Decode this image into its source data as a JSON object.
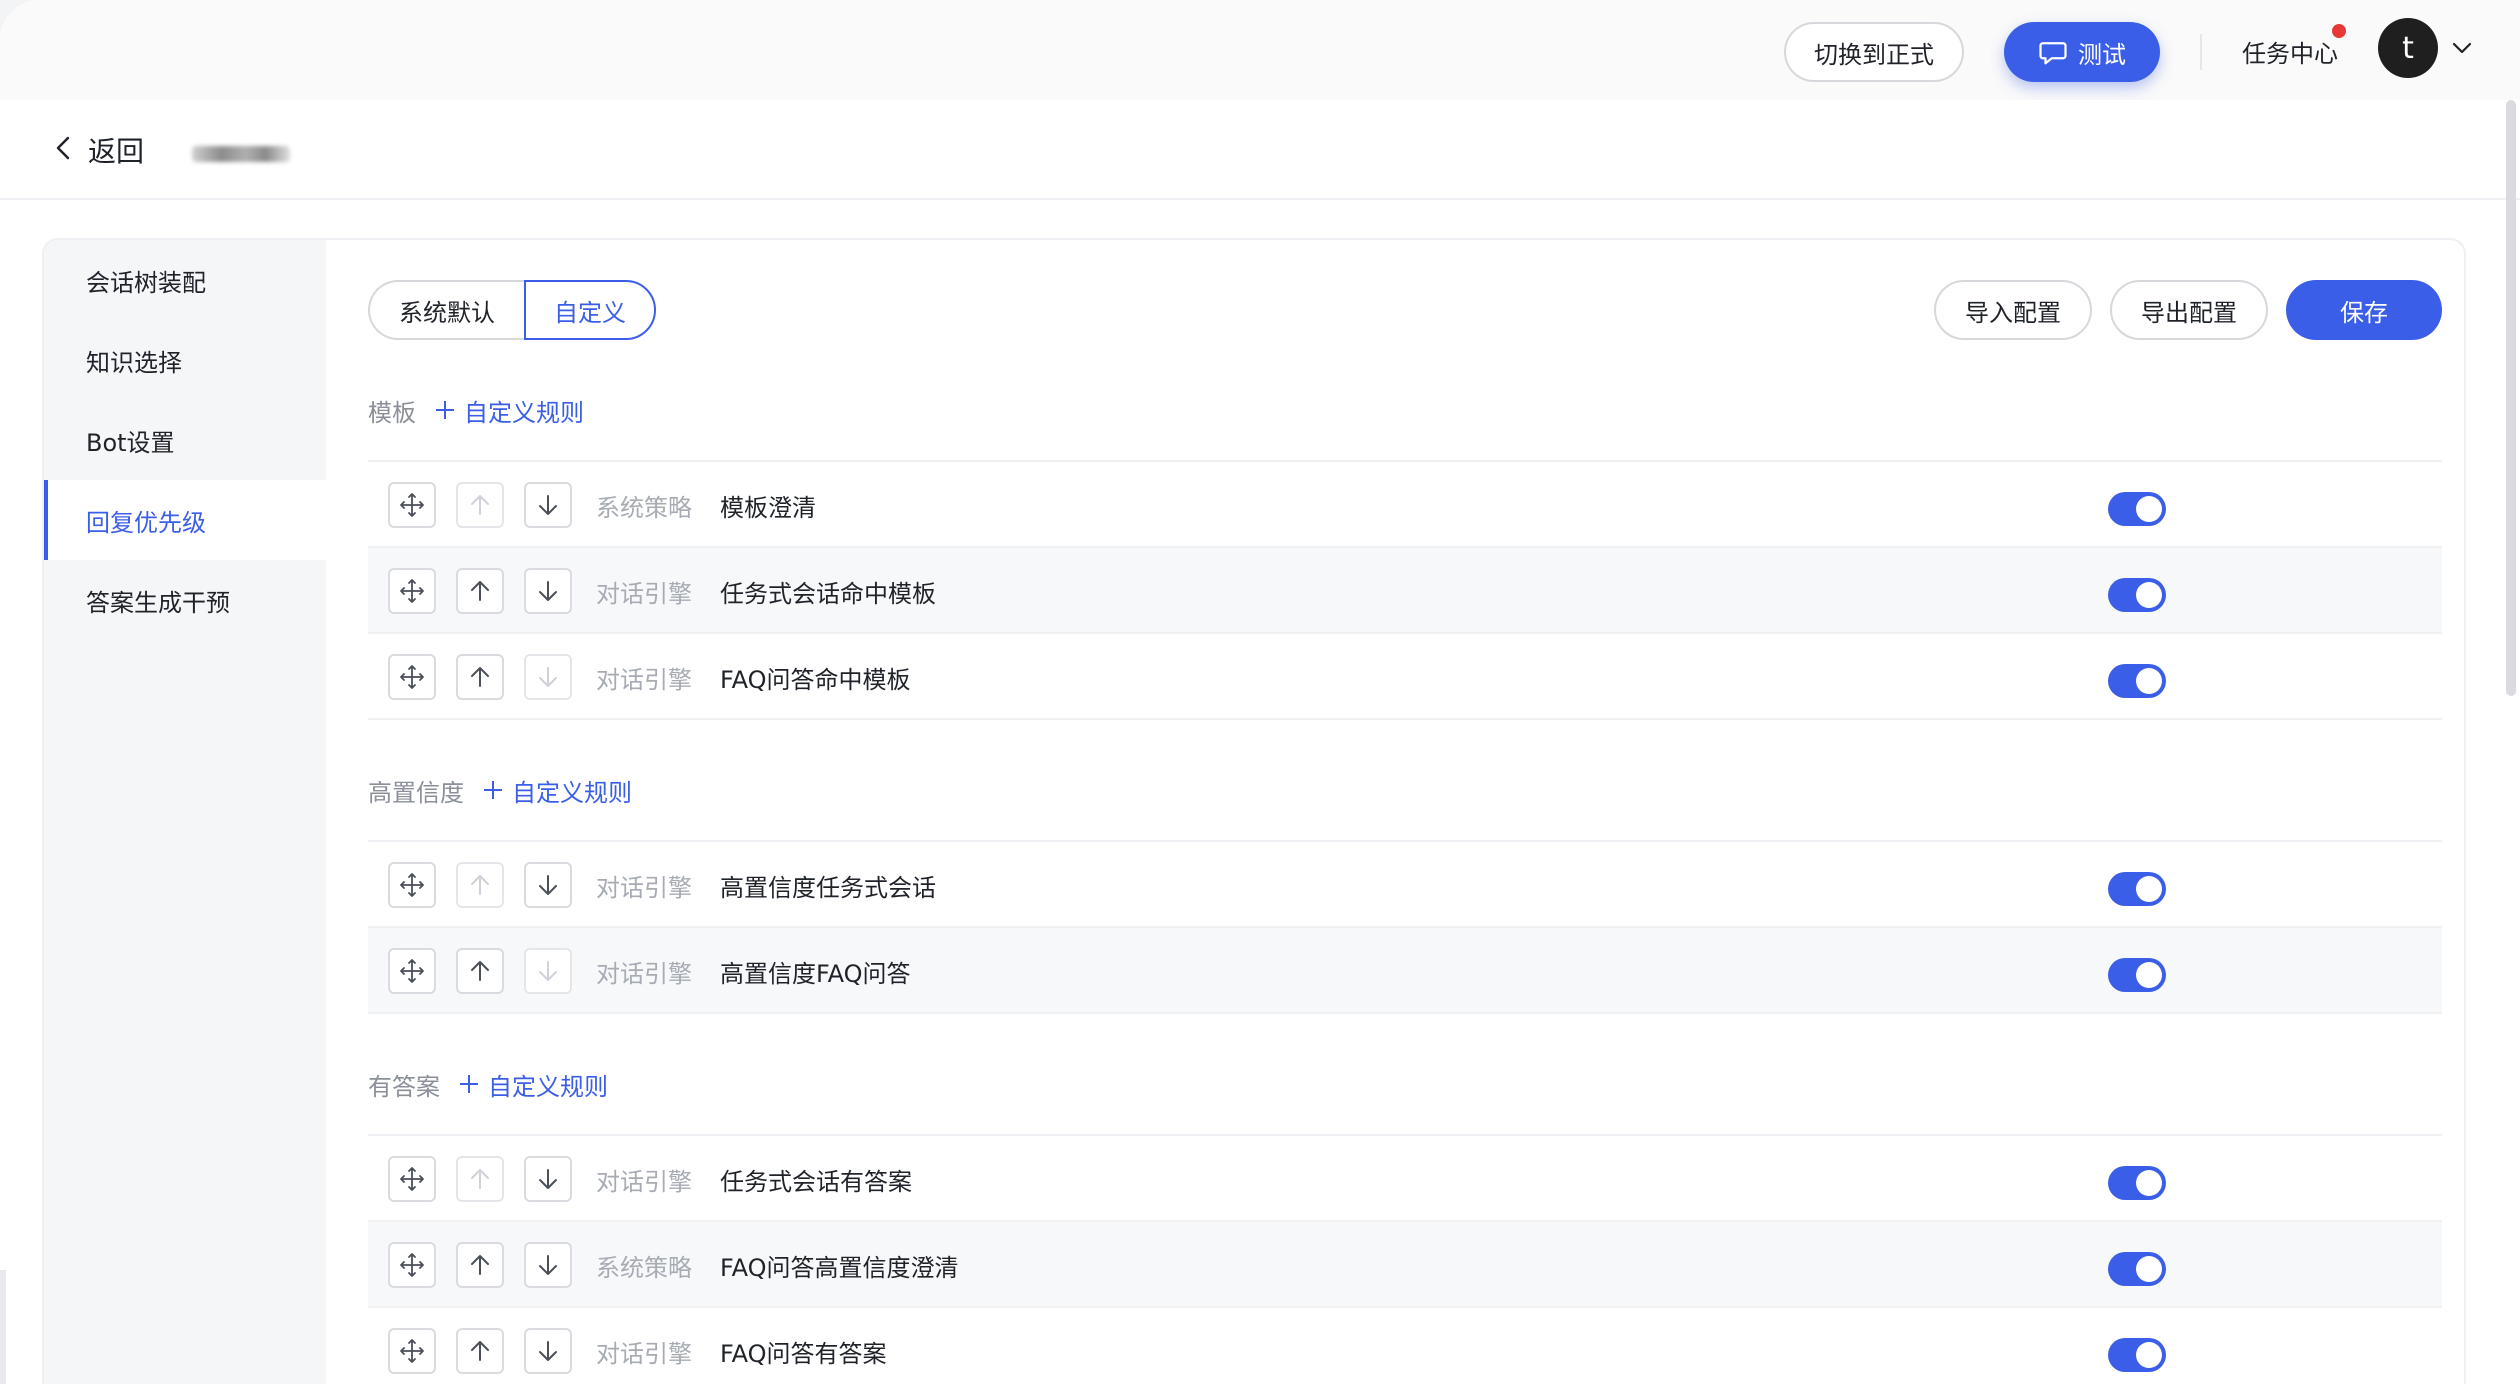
{
  "header": {
    "switch_label": "切换到正式",
    "test_label": "测试",
    "task_center_label": "任务中心",
    "avatar_letter": "t"
  },
  "subheader": {
    "back_label": "返回"
  },
  "sidebar": {
    "items": [
      {
        "label": "会话树装配"
      },
      {
        "label": "知识选择"
      },
      {
        "label": "Bot设置"
      },
      {
        "label": "回复优先级",
        "active": true
      },
      {
        "label": "答案生成干预"
      }
    ]
  },
  "toolbar": {
    "mode_default": "系统默认",
    "mode_custom": "自定义",
    "selected_mode": "自定义",
    "import_label": "导入配置",
    "export_label": "导出配置",
    "save_label": "保存"
  },
  "sections": [
    {
      "title": "模板",
      "add_label": "自定义规则",
      "rules": [
        {
          "source": "系统策略",
          "name": "模板澄清",
          "enabled": true
        },
        {
          "source": "对话引擎",
          "name": "任务式会话命中模板",
          "enabled": true
        },
        {
          "source": "对话引擎",
          "name": "FAQ问答命中模板",
          "enabled": true
        }
      ]
    },
    {
      "title": "高置信度",
      "add_label": "自定义规则",
      "rules": [
        {
          "source": "对话引擎",
          "name": "高置信度任务式会话",
          "enabled": true
        },
        {
          "source": "对话引擎",
          "name": "高置信度FAQ问答",
          "enabled": true
        }
      ]
    },
    {
      "title": "有答案",
      "add_label": "自定义规则",
      "rules": [
        {
          "source": "对话引擎",
          "name": "任务式会话有答案",
          "enabled": true
        },
        {
          "source": "系统策略",
          "name": "FAQ问答高置信度澄清",
          "enabled": true
        },
        {
          "source": "对话引擎",
          "name": "FAQ问答有答案",
          "enabled": true
        }
      ]
    }
  ],
  "colors": {
    "accent": "#3b5ee8",
    "notification": "#e53935"
  }
}
